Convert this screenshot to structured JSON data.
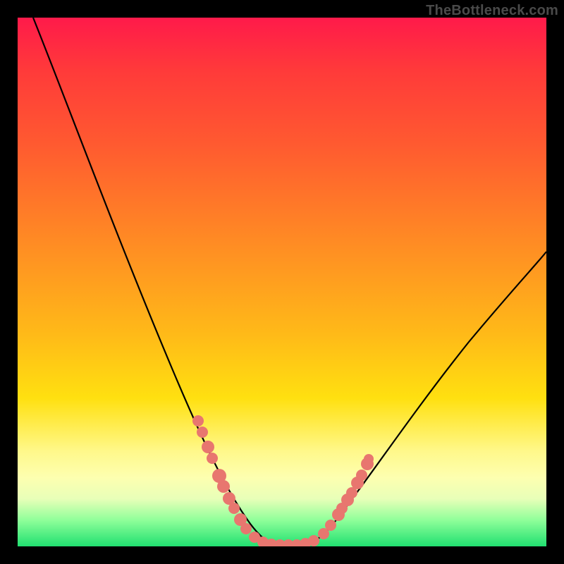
{
  "watermark": "TheBottleneck.com",
  "chart_data": {
    "type": "line",
    "title": "",
    "xlabel": "",
    "ylabel": "",
    "xlim": [
      0,
      100
    ],
    "ylim": [
      0,
      100
    ],
    "grid": false,
    "series": [
      {
        "name": "bottleneck-curve",
        "x": [
          3,
          10,
          20,
          30,
          35,
          40,
          43,
          45,
          47,
          49,
          51,
          55,
          60,
          70,
          80,
          90,
          100
        ],
        "y": [
          100,
          85,
          62,
          38,
          25,
          12,
          5,
          1,
          0,
          0,
          0,
          1,
          5,
          18,
          30,
          40,
          48
        ]
      }
    ],
    "annotations": {
      "dot_clusters": [
        {
          "name": "left-slope-dots",
          "approx_x_range": [
            34,
            43
          ],
          "approx_y_range": [
            2,
            24
          ]
        },
        {
          "name": "valley-dots",
          "approx_x_range": [
            44,
            55
          ],
          "approx_y_range": [
            0,
            1
          ]
        },
        {
          "name": "right-slope-dots",
          "approx_x_range": [
            56,
            62
          ],
          "approx_y_range": [
            2,
            16
          ]
        }
      ],
      "dot_color": "#e8766f"
    },
    "background_gradient": [
      "#ff1a4a",
      "#ff9a20",
      "#fff88a",
      "#20e070"
    ]
  }
}
